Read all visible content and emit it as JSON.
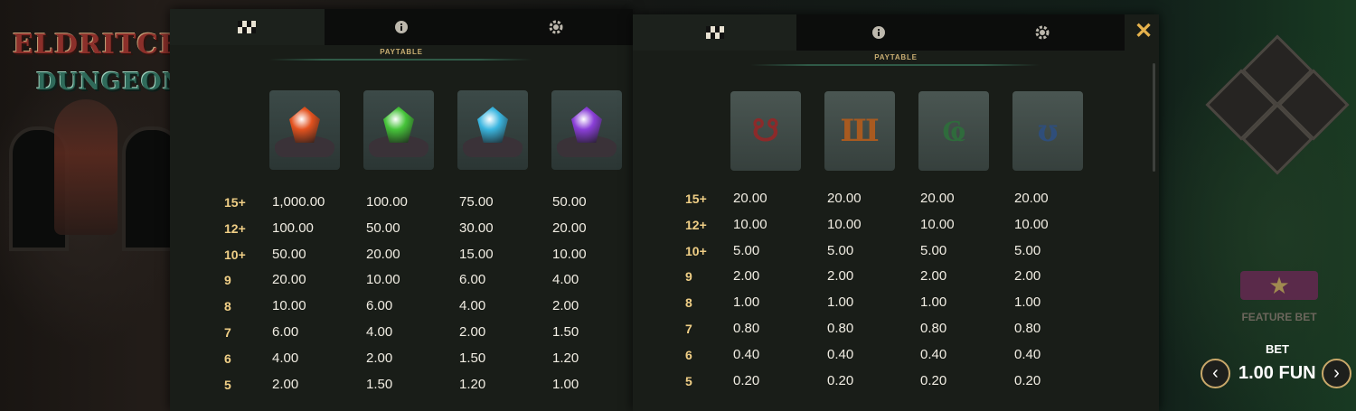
{
  "left_panel": {
    "subtitle": "PAYTABLE",
    "tab_icons": [
      "paytable-icon",
      "info-icon",
      "settings-icon"
    ],
    "symbols": [
      {
        "name": "red-gem-icon",
        "color": "#e3521f"
      },
      {
        "name": "green-gem-icon",
        "color": "#46c43a"
      },
      {
        "name": "blue-gem-icon",
        "color": "#3bb6e0"
      },
      {
        "name": "purple-gem-icon",
        "color": "#8a3fd8"
      }
    ],
    "rows": [
      {
        "label": "15+",
        "values": [
          "1,000.00",
          "100.00",
          "75.00",
          "50.00"
        ]
      },
      {
        "label": "12+",
        "values": [
          "100.00",
          "50.00",
          "30.00",
          "20.00"
        ]
      },
      {
        "label": "10+",
        "values": [
          "50.00",
          "20.00",
          "15.00",
          "10.00"
        ]
      },
      {
        "label": "9",
        "values": [
          "20.00",
          "10.00",
          "6.00",
          "4.00"
        ]
      },
      {
        "label": "8",
        "values": [
          "10.00",
          "6.00",
          "4.00",
          "2.00"
        ]
      },
      {
        "label": "7",
        "values": [
          "6.00",
          "4.00",
          "2.00",
          "1.50"
        ]
      },
      {
        "label": "6",
        "values": [
          "4.00",
          "2.00",
          "1.50",
          "1.20"
        ]
      },
      {
        "label": "5",
        "values": [
          "2.00",
          "1.50",
          "1.20",
          "1.00"
        ]
      }
    ]
  },
  "right_panel": {
    "subtitle": "PAYTABLE",
    "tab_icons": [
      "paytable-icon",
      "info-icon",
      "settings-icon"
    ],
    "close_label": "✕",
    "symbols": [
      {
        "name": "red-rune-icon",
        "color": "#8c2a2a"
      },
      {
        "name": "orange-rune-icon",
        "color": "#a85a20"
      },
      {
        "name": "green-rune-icon",
        "color": "#2f6b3c"
      },
      {
        "name": "blue-rune-icon",
        "color": "#2f4e7a"
      }
    ],
    "rows": [
      {
        "label": "15+",
        "values": [
          "20.00",
          "20.00",
          "20.00",
          "20.00"
        ]
      },
      {
        "label": "12+",
        "values": [
          "10.00",
          "10.00",
          "10.00",
          "10.00"
        ]
      },
      {
        "label": "10+",
        "values": [
          "5.00",
          "5.00",
          "5.00",
          "5.00"
        ]
      },
      {
        "label": "9",
        "values": [
          "2.00",
          "2.00",
          "2.00",
          "2.00"
        ]
      },
      {
        "label": "8",
        "values": [
          "1.00",
          "1.00",
          "1.00",
          "1.00"
        ]
      },
      {
        "label": "7",
        "values": [
          "0.80",
          "0.80",
          "0.80",
          "0.80"
        ]
      },
      {
        "label": "6",
        "values": [
          "0.40",
          "0.40",
          "0.40",
          "0.40"
        ]
      },
      {
        "label": "5",
        "values": [
          "0.20",
          "0.20",
          "0.20",
          "0.20"
        ]
      }
    ]
  },
  "game": {
    "logo_line1": "ELDRITCH",
    "logo_line2": "DUNGEON",
    "feature_bet_label": "FEATURE BET",
    "bet_label": "BET",
    "bet_value": "1.00 FUN",
    "prev_label": "‹",
    "next_label": "›",
    "star": "★"
  }
}
